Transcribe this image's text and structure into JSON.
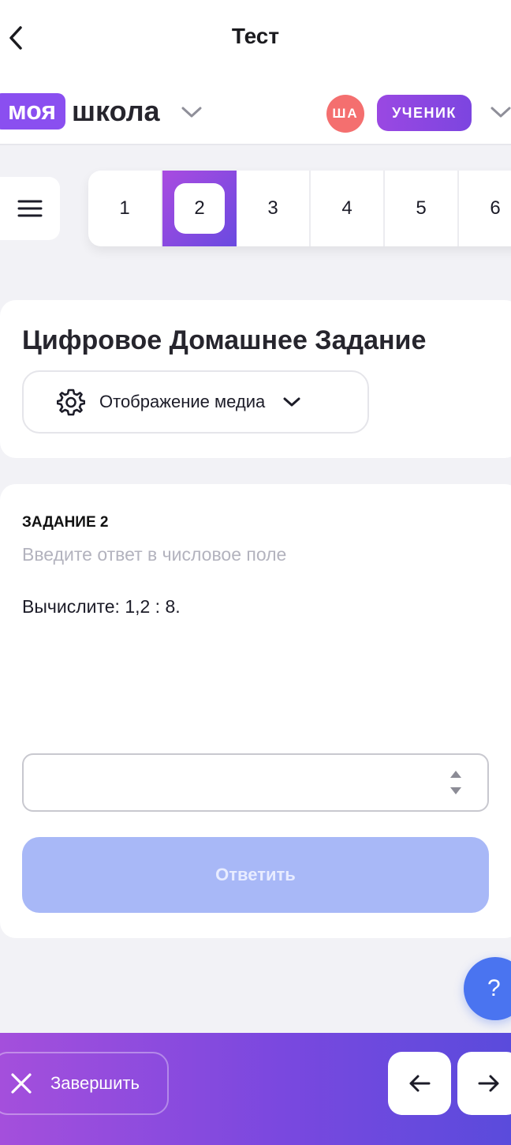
{
  "header": {
    "title": "Тест",
    "back_icon": "chevron-left-icon"
  },
  "brand": {
    "logo_part1": "моя",
    "logo_part2": "школа",
    "avatar_initials": "ША",
    "role": "УЧЕНИК",
    "colors": {
      "brand_purple": "#8a4ff0",
      "avatar_red": "#f46f6f"
    }
  },
  "question_nav": {
    "items": [
      "1",
      "2",
      "3",
      "4",
      "5",
      "6"
    ],
    "active": "2"
  },
  "assignment": {
    "title": "Цифровое Домашнее Задание",
    "media_select": {
      "label": "Отображение медиа",
      "icon": "gear-icon"
    }
  },
  "task": {
    "label": "ЗАДАНИЕ 2",
    "hint": "Введите ответ в числовое поле",
    "text": "Вычислите: 1,2 : 8.",
    "answer_value": "",
    "answer_placeholder": "",
    "submit_label": "Ответить"
  },
  "help": {
    "label": "?"
  },
  "footer": {
    "finish_label": "Завершить",
    "prev_icon": "arrow-left-icon",
    "next_icon": "arrow-right-icon",
    "colors": {
      "gradient_start": "#a44fdc",
      "gradient_end": "#5a4bdc"
    }
  }
}
